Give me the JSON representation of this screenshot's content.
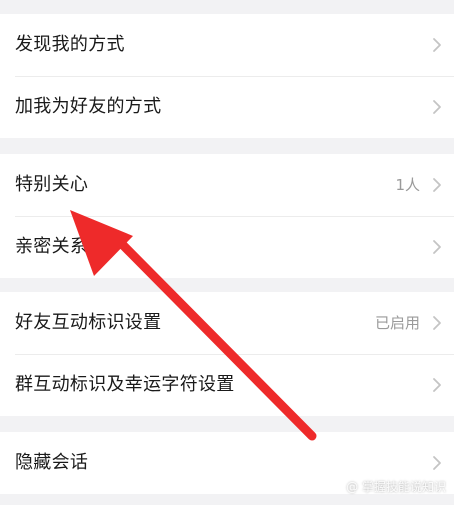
{
  "settings": {
    "items": [
      {
        "label": "发现我的方式",
        "value": ""
      },
      {
        "label": "加我为好友的方式",
        "value": ""
      },
      {
        "label": "特别关心",
        "value": "1人"
      },
      {
        "label": "亲密关系",
        "value": ""
      },
      {
        "label": "好友互动标识设置",
        "value": "已启用"
      },
      {
        "label": "群互动标识及幸运字符设置",
        "value": ""
      },
      {
        "label": "隐藏会话",
        "value": ""
      }
    ]
  },
  "colors": {
    "background": "#f2f2f4",
    "row_background": "#ffffff",
    "text": "#1a1a1a",
    "secondary_text": "#9a9a9a",
    "chevron": "#c4c4c4",
    "annotation_arrow": "#ee2a2a"
  },
  "icons": {
    "chevron": "chevron-right-icon"
  },
  "watermark": "@ 掌握技能说知识"
}
